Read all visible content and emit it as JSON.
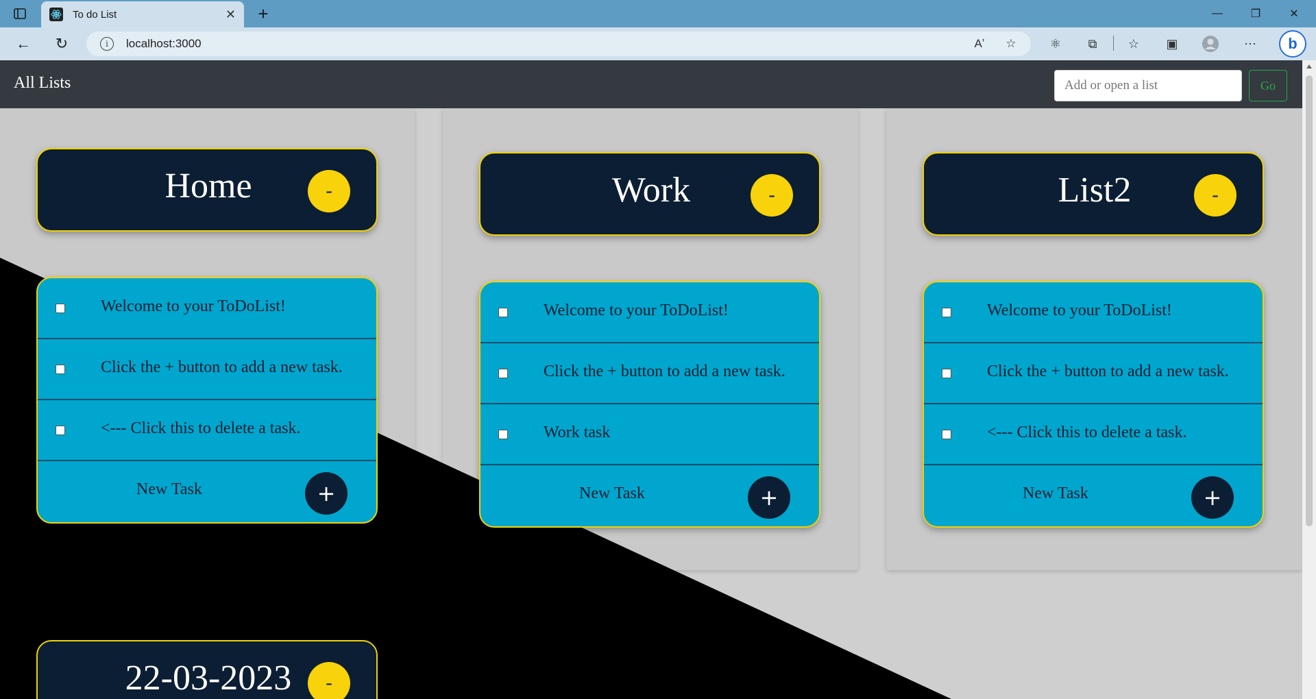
{
  "browser": {
    "tab_title": "To do List",
    "url": "localhost:3000"
  },
  "app": {
    "brand": "All Lists",
    "search_placeholder": "Add or open a list",
    "go_label": "Go"
  },
  "lists": [
    {
      "name": "Home",
      "remove_label": "-",
      "tasks": [
        "Welcome to your ToDoList!",
        "Click the + button to add a new task.",
        "<--- Click this to delete a task."
      ],
      "new_task_label": "New Task",
      "add_label": "+"
    },
    {
      "name": "Work",
      "remove_label": "-",
      "tasks": [
        "Welcome to your ToDoList!",
        "Click the + button to add a new task.",
        "Work task"
      ],
      "new_task_label": "New Task",
      "add_label": "+"
    },
    {
      "name": "List2",
      "remove_label": "-",
      "tasks": [
        "Welcome to your ToDoList!",
        "Click the + button to add a new task.",
        "<--- Click this to delete a task."
      ],
      "new_task_label": "New Task",
      "add_label": "+"
    },
    {
      "name": "22-03-2023",
      "remove_label": "-"
    }
  ],
  "colors": {
    "navbar": "#343a40",
    "header_card": "#0c1e33",
    "accent_yellow": "#f8d20a",
    "task_card": "#00a6cd",
    "go_green": "#28a745"
  }
}
